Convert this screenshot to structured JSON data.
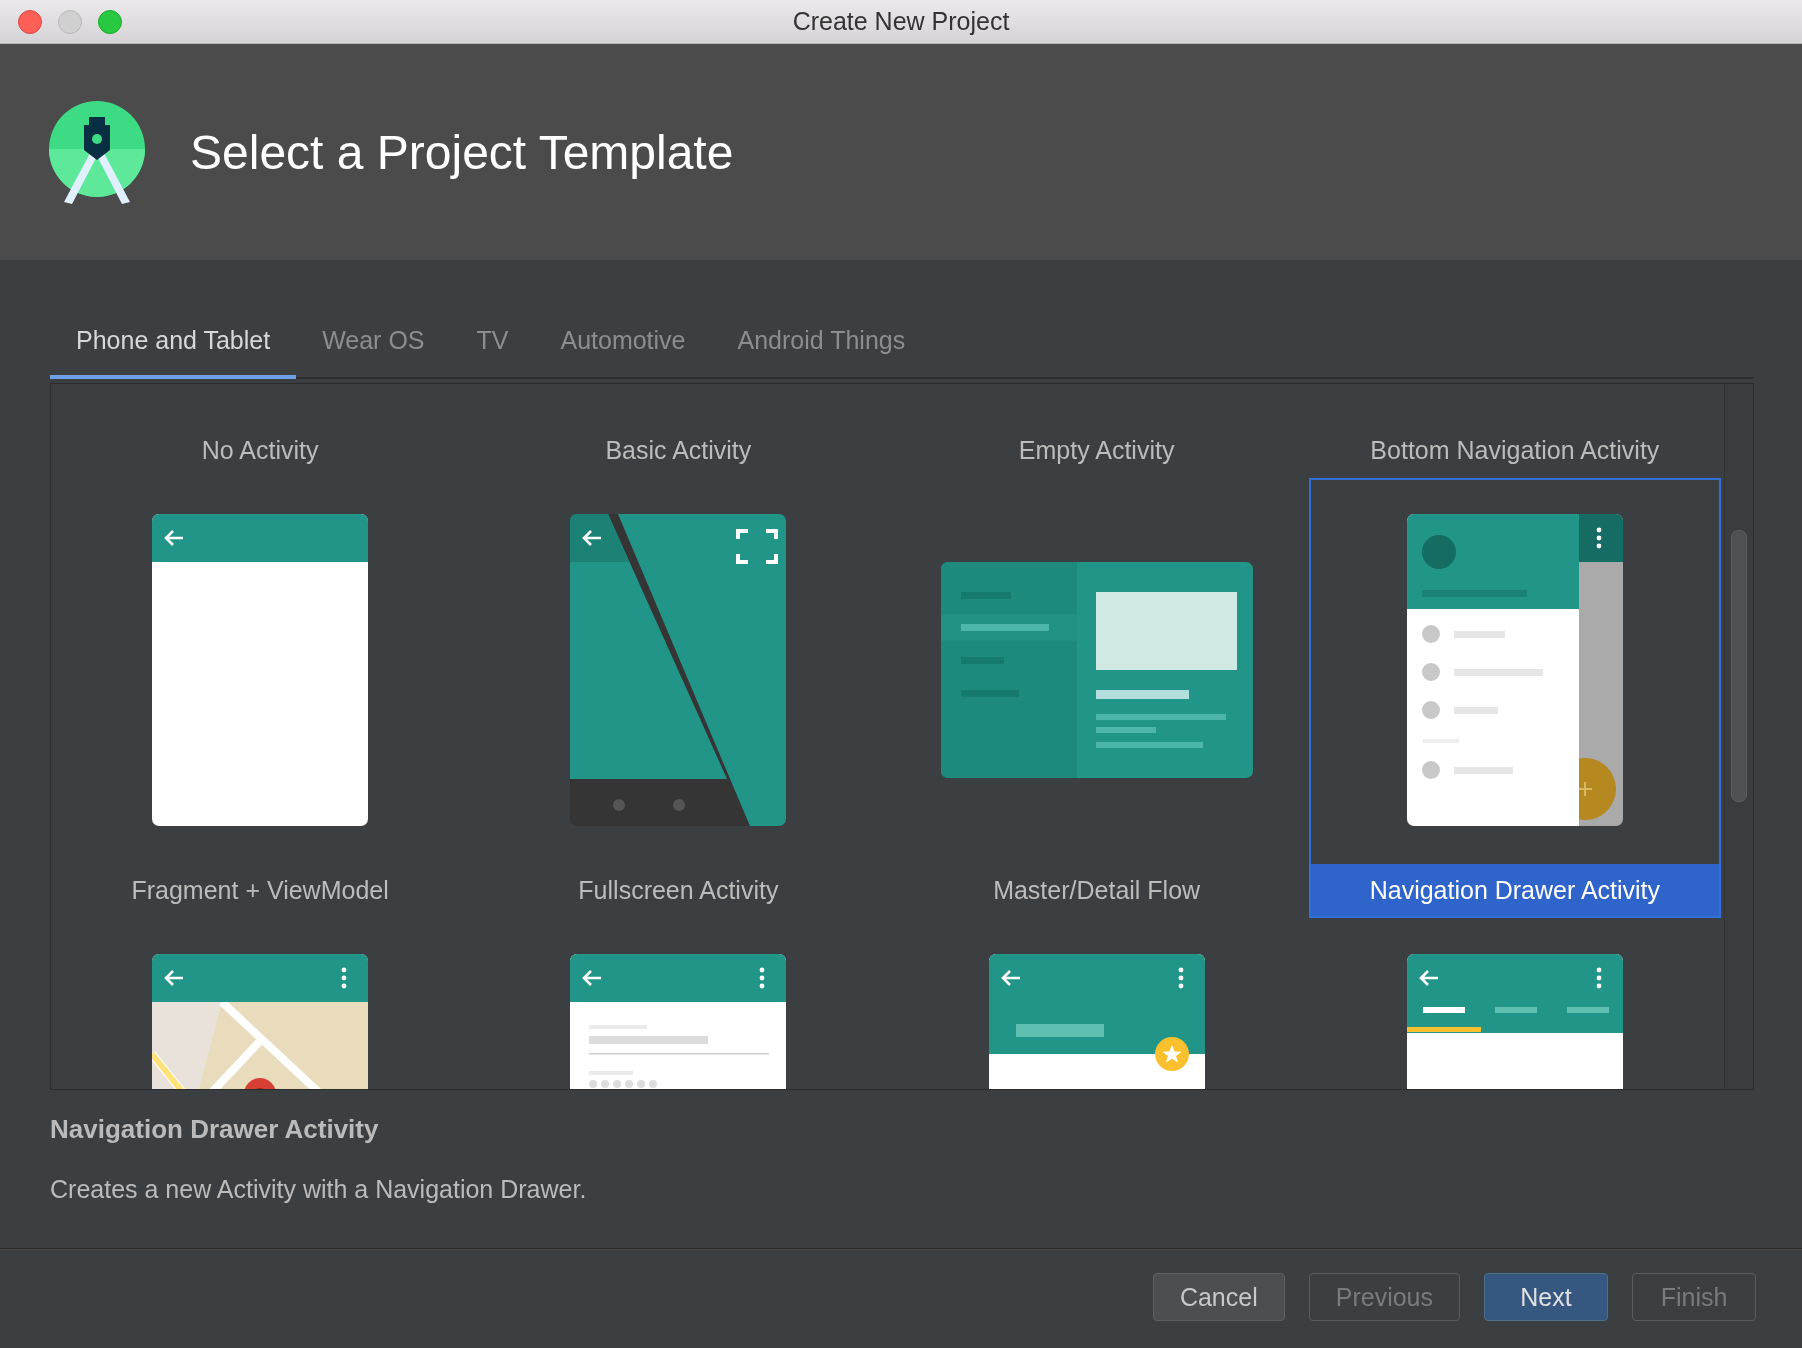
{
  "window": {
    "title": "Create New Project"
  },
  "header": {
    "title": "Select a Project Template"
  },
  "tabs": [
    {
      "label": "Phone and Tablet",
      "selected": true
    },
    {
      "label": "Wear OS",
      "selected": false
    },
    {
      "label": "TV",
      "selected": false
    },
    {
      "label": "Automotive",
      "selected": false
    },
    {
      "label": "Android Things",
      "selected": false
    }
  ],
  "templates": [
    {
      "kind": "caption",
      "label": "No Activity",
      "selected": false
    },
    {
      "kind": "caption",
      "label": "Basic Activity",
      "selected": false
    },
    {
      "kind": "caption",
      "label": "Empty Activity",
      "selected": false
    },
    {
      "kind": "caption",
      "label": "Bottom Navigation Activity",
      "selected": false
    },
    {
      "kind": "blank",
      "label": "Fragment + ViewModel",
      "selected": false
    },
    {
      "kind": "diagonal",
      "label": "Fullscreen Activity",
      "selected": false
    },
    {
      "kind": "tablet",
      "label": "Master/Detail Flow",
      "selected": false
    },
    {
      "kind": "drawer",
      "label": "Navigation Drawer Activity",
      "selected": true
    },
    {
      "kind": "map",
      "selected": false
    },
    {
      "kind": "list",
      "selected": false
    },
    {
      "kind": "fab",
      "selected": false
    },
    {
      "kind": "tabs",
      "selected": false
    }
  ],
  "details": {
    "title": "Navigation Drawer Activity",
    "description": "Creates a new Activity with a Navigation Drawer."
  },
  "buttons": [
    {
      "label": "Cancel",
      "kind": "normal",
      "disabled": false
    },
    {
      "label": "Previous",
      "kind": "normal",
      "disabled": true
    },
    {
      "label": "Next",
      "kind": "default",
      "disabled": false
    },
    {
      "label": "Finish",
      "kind": "normal",
      "disabled": true
    }
  ]
}
